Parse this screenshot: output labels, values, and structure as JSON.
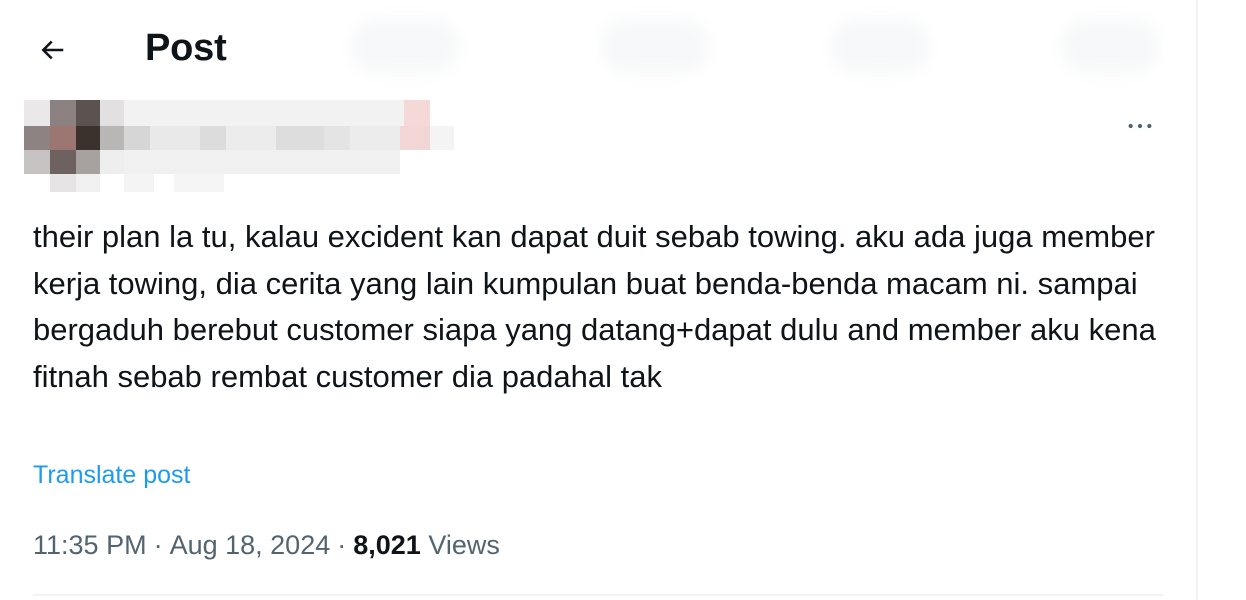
{
  "header": {
    "title": "Post",
    "back_icon": "arrow-left-icon"
  },
  "post": {
    "more_icon": "more-horizontal-icon",
    "text": "their plan la tu, kalau excident kan dapat duit sebab towing. aku ada juga member kerja towing, dia cerita yang lain kumpulan buat benda-benda macam ni. sampai bergaduh berebut customer siapa yang datang+dapat dulu and member aku kena fitnah sebab rembat customer dia padahal tak",
    "translate_label": "Translate post",
    "time": "11:35 PM",
    "date": "Aug 18, 2024",
    "separator": "·",
    "views_count": "8,021",
    "views_label": "Views"
  },
  "colors": {
    "text": "#0f1419",
    "secondary": "#536471",
    "link": "#1d9bf0",
    "divider": "#eff3f4"
  }
}
